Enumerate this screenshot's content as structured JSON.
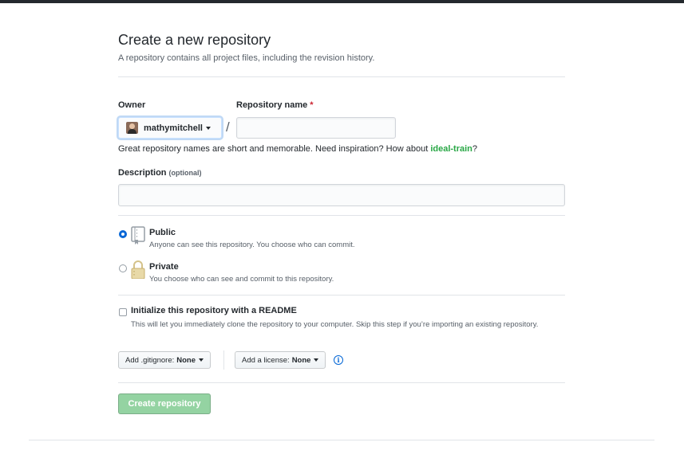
{
  "header": {
    "title": "Create a new repository",
    "subtitle": "A repository contains all project files, including the revision history."
  },
  "owner": {
    "label": "Owner",
    "value": "mathymitchell",
    "icon": "user-avatar"
  },
  "separator": "/",
  "repository_name": {
    "label": "Repository name",
    "required_marker": "*",
    "value": "",
    "placeholder": ""
  },
  "name_hint": {
    "text": "Great repository names are short and memorable. Need inspiration? How about ",
    "suggestion": "ideal-train",
    "suffix": "?"
  },
  "description": {
    "label": "Description",
    "optional_label": "(optional)",
    "value": "",
    "placeholder": ""
  },
  "visibility": {
    "selected": "public",
    "options": [
      {
        "key": "public",
        "title": "Public",
        "note": "Anyone can see this repository. You choose who can commit.",
        "icon": "repo-icon"
      },
      {
        "key": "private",
        "title": "Private",
        "note": "You choose who can see and commit to this repository.",
        "icon": "lock-icon"
      }
    ]
  },
  "readme": {
    "checked": false,
    "title": "Initialize this repository with a README",
    "note": "This will let you immediately clone the repository to your computer. Skip this step if you’re importing an existing repository."
  },
  "gitignore": {
    "label": "Add .gitignore:",
    "value": "None"
  },
  "license": {
    "label": "Add a license:",
    "value": "None"
  },
  "info_icon": "info-icon",
  "submit": {
    "label": "Create repository",
    "disabled": true
  },
  "colors": {
    "accent": "#0366d6",
    "success": "#28a745",
    "button_disabled": "#94d3a2",
    "required": "#cb2431"
  }
}
